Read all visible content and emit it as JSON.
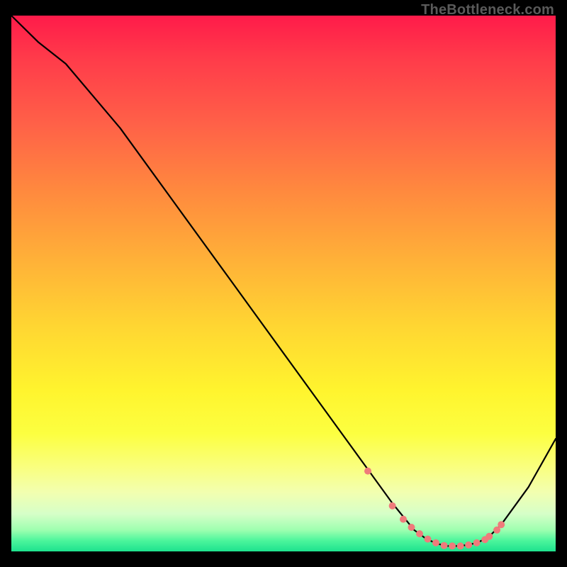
{
  "watermark": "TheBottleneck.com",
  "chart_data": {
    "type": "line",
    "title": "",
    "xlabel": "",
    "ylabel": "",
    "xlim": [
      0,
      100
    ],
    "ylim": [
      0,
      100
    ],
    "series": [
      {
        "name": "curve",
        "x": [
          0,
          5,
          10,
          20,
          30,
          40,
          50,
          60,
          65,
          70,
          74,
          76,
          78,
          80,
          82,
          84,
          86,
          88,
          90,
          95,
          100
        ],
        "y": [
          100,
          95,
          91,
          79,
          65,
          51,
          37,
          23,
          16,
          9,
          4,
          2.5,
          1.5,
          1,
          1,
          1.2,
          1.8,
          3,
          5,
          12,
          21
        ]
      }
    ],
    "markers": {
      "name": "points",
      "x": [
        65.5,
        70.0,
        72.0,
        73.5,
        75.0,
        76.5,
        78.0,
        79.5,
        81.0,
        82.5,
        84.0,
        85.5,
        87.0,
        87.8,
        89.2,
        90.0
      ],
      "y": [
        15.0,
        8.5,
        6.0,
        4.5,
        3.3,
        2.3,
        1.6,
        1.1,
        1.0,
        1.0,
        1.2,
        1.6,
        2.2,
        2.8,
        4.0,
        5.0
      ]
    },
    "grid": false,
    "legend": false
  },
  "colors": {
    "curve": "#000000",
    "markers": "#ef7b7b"
  }
}
